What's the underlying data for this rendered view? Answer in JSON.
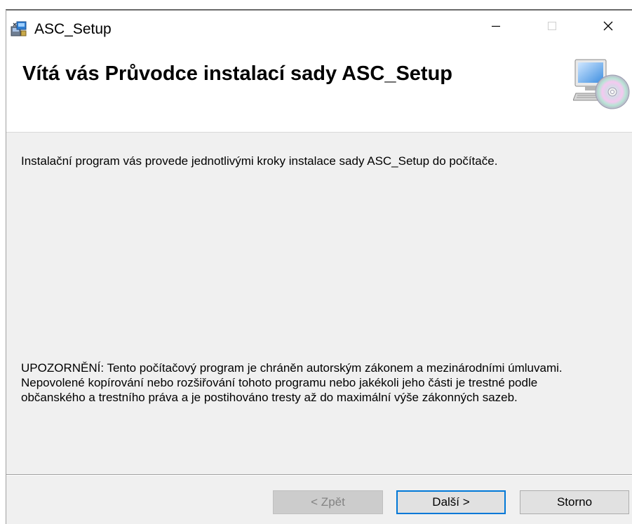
{
  "window": {
    "title": "ASC_Setup",
    "controls": {
      "minimize": "minimize-icon",
      "maximize": "maximize-icon",
      "close": "close-icon"
    }
  },
  "header": {
    "title": "Vítá vás Průvodce instalací sady ASC_Setup",
    "graphic": "computer-cd-icon"
  },
  "body": {
    "intro": "Instalační program vás provede jednotlivými kroky instalace sady ASC_Setup do počítače.",
    "warning": "UPOZORNĚNÍ: Tento počítačový program je chráněn autorským zákonem a mezinárodními úmluvami. Nepovolené kopírování nebo rozšiřování tohoto programu nebo jakékoli jeho části je trestné podle občanského a trestního práva a je postihováno tresty až do maximální výše zákonných sazeb."
  },
  "buttons": {
    "back": "< Zpět",
    "next": "Další >",
    "cancel": "Storno"
  },
  "colors": {
    "accent": "#0078d7",
    "body_bg": "#f0f0f0",
    "disabled_text": "#838383"
  }
}
